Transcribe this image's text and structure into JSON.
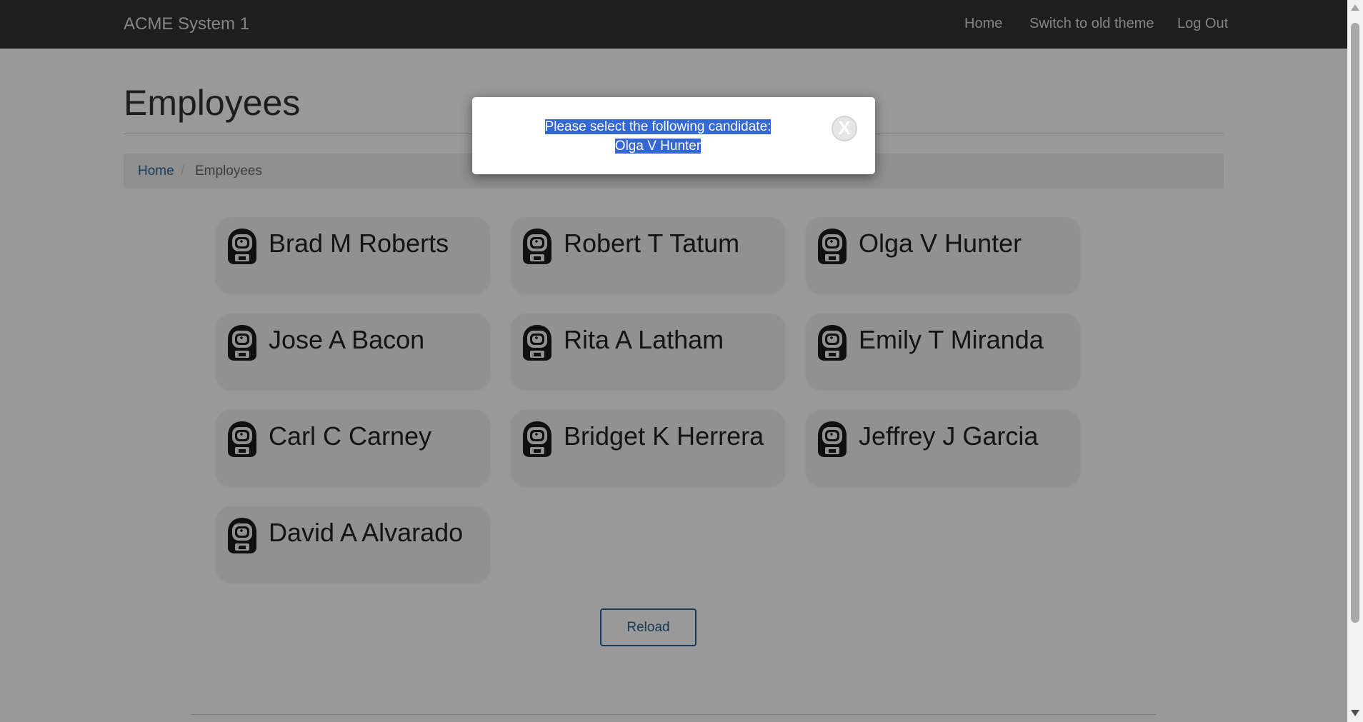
{
  "navbar": {
    "brand": "ACME System 1",
    "links": [
      "Home",
      "Switch to old theme",
      "Log Out"
    ]
  },
  "page": {
    "title": "Employees",
    "breadcrumb": {
      "home": "Home",
      "separator": "/",
      "current": "Employees"
    }
  },
  "employees": [
    "Brad M Roberts",
    "Robert T Tatum",
    "Olga V Hunter",
    "Jose A Bacon",
    "Rita A Latham",
    "Emily T Miranda",
    "Carl C Carney",
    "Bridget K Herrera",
    "Jeffrey J Garcia",
    "David A Alvarado"
  ],
  "reload_label": "Reload",
  "modal": {
    "line1": "Please select the following candidate:",
    "line2": "Olga V Hunter",
    "close_label": "X"
  },
  "icons": {
    "employee": "astronaut-icon",
    "close": "close-icon"
  },
  "colors": {
    "navbar": "#333333",
    "link": "#2a6496",
    "selection": "#3367d6"
  }
}
